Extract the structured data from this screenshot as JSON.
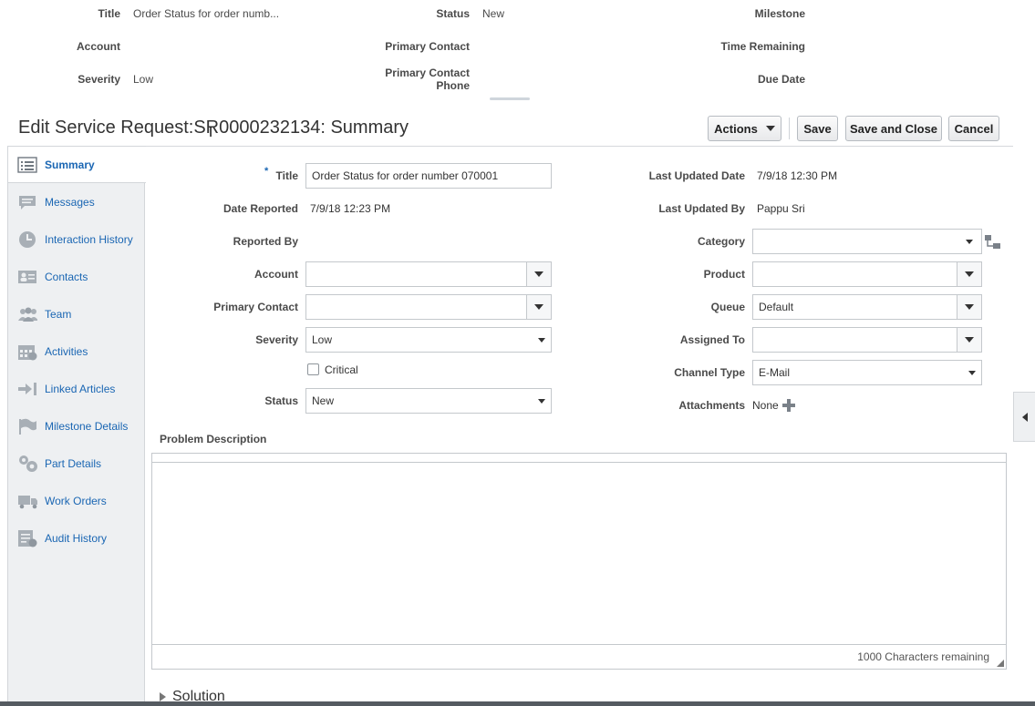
{
  "header": {
    "title_label": "Title",
    "title_value": "Order Status for order numb...",
    "status_label": "Status",
    "status_value": "New",
    "milestone_label": "Milestone",
    "account_label": "Account",
    "primary_contact_label": "Primary Contact",
    "time_remaining_label": "Time Remaining",
    "severity_label": "Severity",
    "severity_value": "Low",
    "primary_contact_phone_label_1": "Primary Contact",
    "primary_contact_phone_label_2": "Phone",
    "due_date_label": "Due Date"
  },
  "page_title": "Edit Service Request:SR0000232134: Summary",
  "toolbar": {
    "actions_label": "Actions",
    "save_label": "Save",
    "save_close_label": "Save and Close",
    "cancel_label": "Cancel"
  },
  "sidebar": {
    "items": [
      {
        "label": "Summary",
        "icon": "list-icon",
        "active": true
      },
      {
        "label": "Messages",
        "icon": "chat-icon"
      },
      {
        "label": "Interaction History",
        "icon": "clock-icon"
      },
      {
        "label": "Contacts",
        "icon": "contact-card-icon"
      },
      {
        "label": "Team",
        "icon": "team-icon"
      },
      {
        "label": "Activities",
        "icon": "calendar-icon"
      },
      {
        "label": "Linked Articles",
        "icon": "link-arrow-icon"
      },
      {
        "label": "Milestone Details",
        "icon": "flag-icon"
      },
      {
        "label": "Part Details",
        "icon": "gears-icon"
      },
      {
        "label": "Work Orders",
        "icon": "truck-icon"
      },
      {
        "label": "Audit History",
        "icon": "audit-icon"
      }
    ]
  },
  "form": {
    "required_mark": "*",
    "title_label": "Title",
    "title_value": "Order Status for order number 070001",
    "date_reported_label": "Date Reported",
    "date_reported_value": "7/9/18 12:23 PM",
    "reported_by_label": "Reported By",
    "account_label": "Account",
    "account_value": "",
    "primary_contact_label": "Primary Contact",
    "primary_contact_value": "",
    "severity_label": "Severity",
    "severity_value": "Low",
    "critical_label": "Critical",
    "status_label": "Status",
    "status_value": "New",
    "last_updated_date_label": "Last Updated Date",
    "last_updated_date_value": "7/9/18 12:30 PM",
    "last_updated_by_label": "Last Updated By",
    "last_updated_by_value": "Pappu Sri",
    "category_label": "Category",
    "category_value": "",
    "product_label": "Product",
    "product_value": "",
    "queue_label": "Queue",
    "queue_value": "Default",
    "assigned_to_label": "Assigned To",
    "assigned_to_value": "",
    "channel_type_label": "Channel Type",
    "channel_type_value": "E-Mail",
    "attachments_label": "Attachments",
    "attachments_value": "None"
  },
  "problem_description": {
    "label": "Problem Description",
    "chars_remaining": "1000 Characters remaining"
  },
  "solution_label": "Solution",
  "colors": {
    "link": "#1a66b3",
    "sidebar_bg": "#eef0f2",
    "border": "#c4c8cc"
  }
}
